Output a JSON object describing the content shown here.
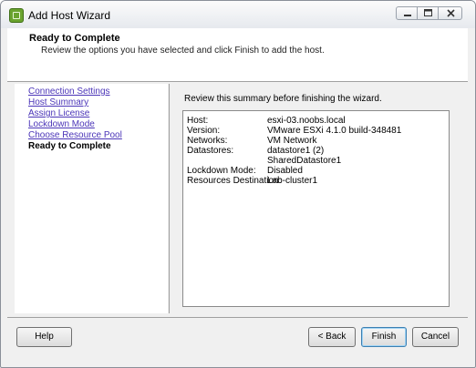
{
  "window": {
    "title": "Add Host Wizard"
  },
  "header": {
    "title": "Ready to Complete",
    "subtitle": "Review the options you have selected and click Finish to add the host."
  },
  "nav": {
    "items": [
      {
        "label": "Connection Settings"
      },
      {
        "label": "Host Summary"
      },
      {
        "label": "Assign License"
      },
      {
        "label": "Lockdown Mode"
      },
      {
        "label": "Choose Resource Pool"
      },
      {
        "label": "Ready to Complete"
      }
    ]
  },
  "content": {
    "review_text": "Review this summary before finishing the wizard.",
    "summary": {
      "host_label": "Host:",
      "host_value": "esxi-03.noobs.local",
      "version_label": "Version:",
      "version_value": "VMware ESXi 4.1.0 build-348481",
      "networks_label": "Networks:",
      "networks_value": "VM Network",
      "datastores_label": "Datastores:",
      "datastores_values": [
        "datastore1 (2)",
        "SharedDatastore1"
      ],
      "lockdown_label": "Lockdown Mode:",
      "lockdown_value": "Disabled",
      "resources_label": "Resources Destination:",
      "resources_value": "Lab-cluster1"
    }
  },
  "buttons": {
    "help": "Help",
    "back": "< Back",
    "finish": "Finish",
    "cancel": "Cancel"
  }
}
